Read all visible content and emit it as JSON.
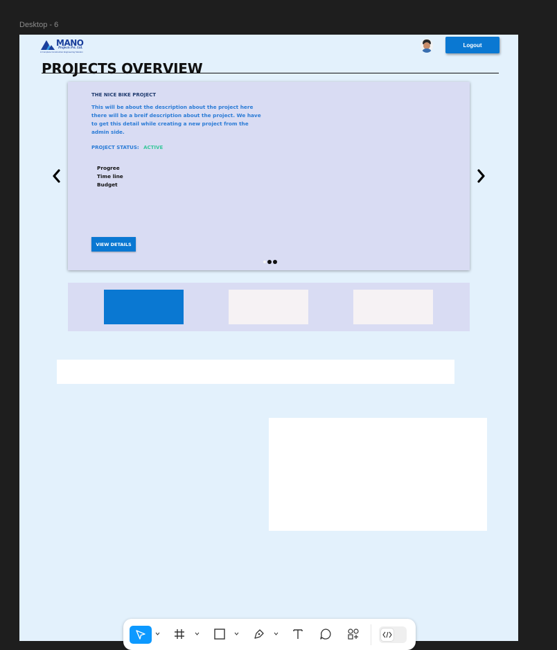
{
  "frame": {
    "label": "Desktop - 6"
  },
  "header": {
    "logo": {
      "name": "MANO",
      "subtitle": "Projects Pvt. Ltd.",
      "tagline": "A Complete Construction Engineering Solution"
    },
    "logout_label": "Logout"
  },
  "page_title": "PROJECTS OVERVIEW",
  "carousel": {
    "project_name": "THE NICE BIKE PROJECT",
    "description": "This will be about the description about the project here there will be a breif description about the project. We have to get this detail while creating a new project from the admin side.",
    "status_label": "PROJECT STATUS:",
    "status_value": "ACTIVE",
    "metrics": [
      "Progree",
      "Time line",
      "Budget"
    ],
    "view_details_label": "VIEW DETAILS",
    "slide_count": 3,
    "active_slide": 1
  },
  "tabs": {
    "count": 3,
    "active_index": 0
  },
  "colors": {
    "frame_bg": "#e3f1fc",
    "card_bg": "#d9dcf3",
    "primary": "#0a78d2",
    "status_active": "#36c79a",
    "description": "#2a7bd6"
  },
  "toolbar": {
    "tools": [
      "move-icon",
      "frame-icon",
      "rectangle-icon",
      "pen-icon",
      "text-icon",
      "comment-icon",
      "actions-icon"
    ],
    "dev_mode_icon": "code-icon"
  }
}
